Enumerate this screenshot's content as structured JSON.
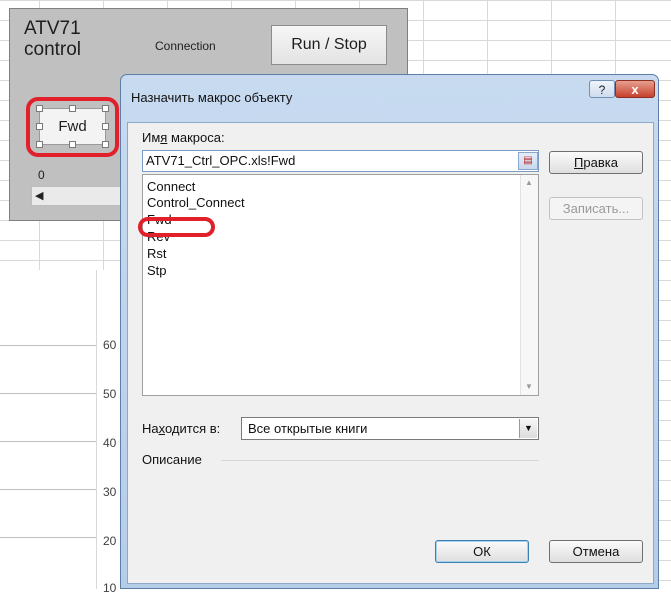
{
  "panel": {
    "title": "ATV71\ncontrol",
    "connection_label": "Connection",
    "run_stop_label": "Run / Stop",
    "fwd_label": "Fwd",
    "scroll_value": "0"
  },
  "chart": {
    "ytick_labels": [
      "60",
      "50",
      "40",
      "30",
      "20",
      "10"
    ]
  },
  "dialog": {
    "title": "Назначить макрос объекту",
    "help_label": "?",
    "close_label": "x",
    "macro_name_label_pre": "Им",
    "macro_name_label_u": "я",
    "macro_name_label_post": " макроса:",
    "macro_name_value": "ATV71_Ctrl_OPC.xls!Fwd",
    "macros": [
      "Connect",
      "Control_Connect",
      "Fwd",
      "Rev",
      "Rst",
      "Stp"
    ],
    "edit_label_u": "П",
    "edit_label_post": "равка",
    "record_label": "Записать...",
    "location_label_pre": "На",
    "location_label_u": "х",
    "location_label_post": "одится в:",
    "location_value": "Все открытые книги",
    "description_label": "Описание",
    "ok_label": "ОК",
    "cancel_label": "Отмена"
  },
  "colors": {
    "highlight": "#e0202a",
    "panel_bg": "#c0c0c0",
    "dialog_frame": "#b6cde8"
  }
}
